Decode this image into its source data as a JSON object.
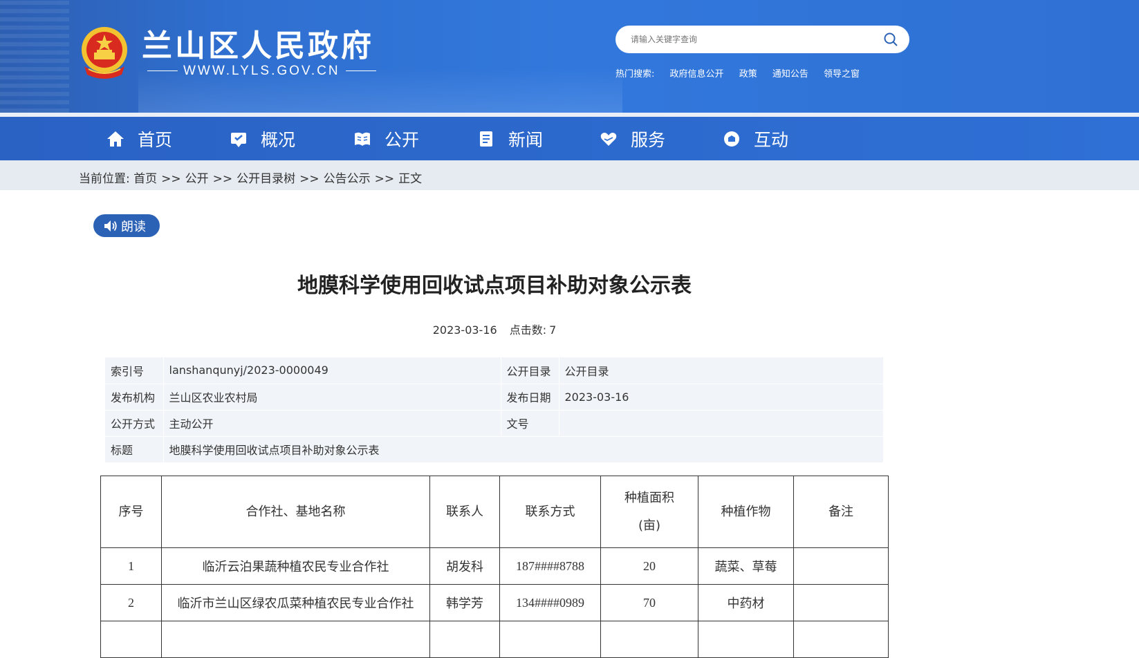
{
  "header": {
    "site_title": "兰山区人民政府",
    "site_url": "WWW.LYLS.GOV.CN",
    "search_placeholder": "请输入关键字查询",
    "hot_label": "热门搜索:",
    "hot_links": [
      "政府信息公开",
      "政策",
      "通知公告",
      "领导之窗"
    ],
    "brand_color": "#2f70d6"
  },
  "nav": {
    "items": [
      {
        "label": "首页",
        "icon": "home-icon"
      },
      {
        "label": "概况",
        "icon": "overview-icon"
      },
      {
        "label": "公开",
        "icon": "book-icon"
      },
      {
        "label": "新闻",
        "icon": "news-icon"
      },
      {
        "label": "服务",
        "icon": "heart-hand-icon"
      },
      {
        "label": "互动",
        "icon": "chat-icon"
      }
    ]
  },
  "breadcrumb": {
    "prefix": "当前位置:",
    "items": [
      "首页",
      "公开",
      "公开目录树",
      "公告公示",
      "正文"
    ],
    "separator": ">>"
  },
  "read_button": {
    "label": "朗读",
    "icon": "speaker-icon"
  },
  "article": {
    "title": "地膜科学使用回收试点项目补助对象公示表",
    "date": "2023-03-16",
    "clicks_label": "点击数:",
    "clicks": "7"
  },
  "info": {
    "index_label": "索引号",
    "index_value": "lanshanqunyj/2023-0000049",
    "catalog_label": "公开目录",
    "catalog_value": "公开目录",
    "org_label": "发布机构",
    "org_value": "兰山区农业农村局",
    "pubdate_label": "发布日期",
    "pubdate_value": "2023-03-16",
    "mode_label": "公开方式",
    "mode_value": "主动公开",
    "docno_label": "文号",
    "docno_value": "",
    "subject_label": "标题",
    "subject_value": "地膜科学使用回收试点项目补助对象公示表"
  },
  "table": {
    "headers": [
      "序号",
      "合作社、基地名称",
      "联系人",
      "联系方式",
      "种植面积",
      "(亩)",
      "种植作物",
      "备注"
    ],
    "rows": [
      {
        "no": "1",
        "name": "临沂云泊果蔬种植农民专业合作社",
        "contact": "胡发科",
        "phone": "187####8788",
        "area": "20",
        "crop": "蔬菜、草莓",
        "note": ""
      },
      {
        "no": "2",
        "name": "临沂市兰山区绿农瓜菜种植农民专业合作社",
        "contact": "韩学芳",
        "phone": "134####0989",
        "area": "70",
        "crop": "中药材",
        "note": ""
      }
    ]
  }
}
